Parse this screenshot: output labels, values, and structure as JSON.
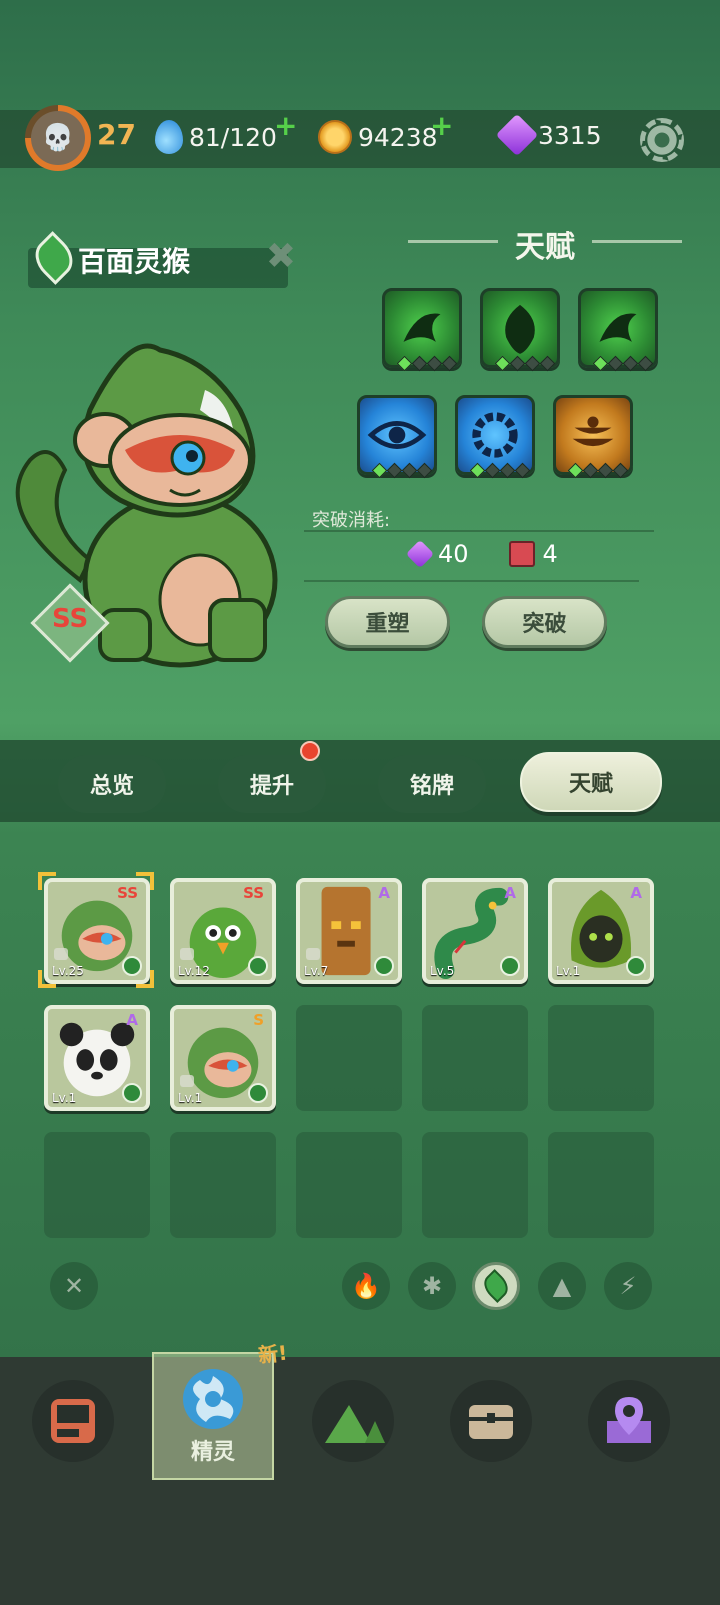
{
  "topbar": {
    "level": "27",
    "energy": "81/120",
    "coins": "94238",
    "gems": "3315"
  },
  "pet": {
    "name": "百面灵猴",
    "rank": "SS"
  },
  "talent": {
    "title": "天赋",
    "slots": [
      {
        "icon": "green-claw-icon",
        "color": "#2c8a33",
        "level": 1
      },
      {
        "icon": "green-drop-icon",
        "color": "#2c8a33",
        "level": 1
      },
      {
        "icon": "green-claw-icon",
        "color": "#2c8a33",
        "level": 1
      },
      {
        "icon": "eye-icon",
        "color": "#2584d8",
        "level": 1
      },
      {
        "icon": "gear-ring-icon",
        "color": "#2584d8",
        "level": 1
      },
      {
        "icon": "bowl-stack-icon",
        "color": "#c27a1e",
        "level": 1
      }
    ],
    "cost_label": "突破消耗:",
    "cost_gems": "40",
    "cost_books": "4",
    "reshape_label": "重塑",
    "breakthrough_label": "突破"
  },
  "tabs": [
    {
      "label": "总览",
      "active": false
    },
    {
      "label": "提升",
      "active": false,
      "badge": true
    },
    {
      "label": "铭牌",
      "active": false
    },
    {
      "label": "天赋",
      "active": true
    }
  ],
  "pets_grid": [
    {
      "name": "green-monkey",
      "rank": "SS",
      "level": "Lv.25",
      "rank_color": "#e8453a",
      "locked": true,
      "selected": true
    },
    {
      "name": "green-parrot",
      "rank": "SS",
      "level": "Lv.12",
      "rank_color": "#e8453a",
      "locked": true
    },
    {
      "name": "wood-totem",
      "rank": "A",
      "level": "Lv.7",
      "rank_color": "#b06ae8",
      "locked": true
    },
    {
      "name": "green-snake",
      "rank": "A",
      "level": "Lv.5",
      "rank_color": "#b06ae8",
      "locked": false
    },
    {
      "name": "hooded-sprite",
      "rank": "A",
      "level": "Lv.1",
      "rank_color": "#b06ae8",
      "locked": false
    },
    {
      "name": "panda",
      "rank": "A",
      "level": "Lv.1",
      "rank_color": "#b06ae8",
      "locked": false
    },
    {
      "name": "green-monkey-small",
      "rank": "S",
      "level": "Lv.1",
      "rank_color": "#f0a028",
      "locked": true
    }
  ],
  "filters": [
    "fire",
    "snowflake",
    "leaf",
    "mountain",
    "lightning"
  ],
  "bottom_nav": {
    "new_tag": "新!",
    "active_label": "精灵",
    "items": [
      "device-icon",
      "spirit-swirl-icon",
      "mountain-tree-icon",
      "chest-icon",
      "map-pin-icon"
    ]
  }
}
